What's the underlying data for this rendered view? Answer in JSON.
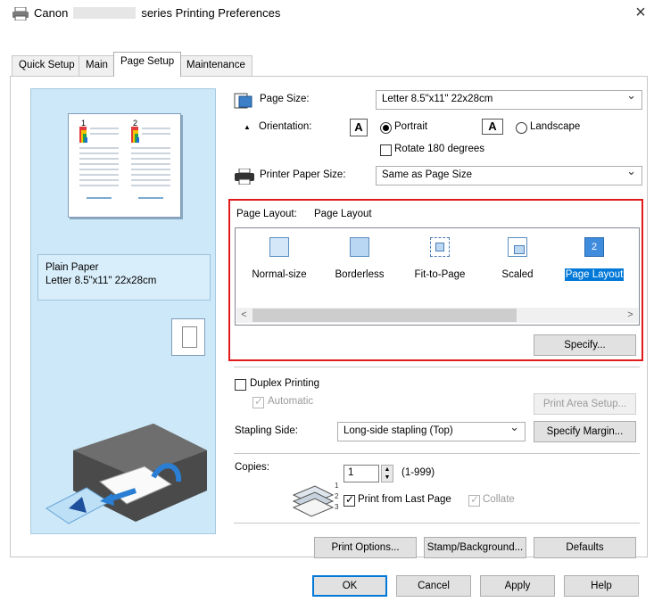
{
  "window": {
    "title_prefix": "Canon",
    "title_suffix": "series Printing Preferences",
    "close_glyph": "×"
  },
  "tabs": [
    {
      "label": "Quick Setup",
      "active": false
    },
    {
      "label": "Main",
      "active": false
    },
    {
      "label": "Page Setup",
      "active": true
    },
    {
      "label": "Maintenance",
      "active": false
    }
  ],
  "preview": {
    "media_type": "Plain Paper",
    "paper_size": "Letter 8.5\"x11\" 22x28cm",
    "page_numbers": [
      "1",
      "2"
    ]
  },
  "page_size": {
    "label": "Page Size:",
    "value": "Letter 8.5\"x11\" 22x28cm"
  },
  "orientation": {
    "label": "Orientation:",
    "portrait_label": "Portrait",
    "landscape_label": "Landscape",
    "selected": "Portrait",
    "portrait_glyph": "A",
    "landscape_glyph": "A",
    "rotate_label": "Rotate 180 degrees",
    "rotate_checked": false
  },
  "printer_paper_size": {
    "label": "Printer Paper Size:",
    "value": "Same as Page Size"
  },
  "page_layout": {
    "label": "Page Layout:",
    "current": "Page Layout",
    "items": [
      {
        "label": "Normal-size",
        "icon": "normal-size-icon"
      },
      {
        "label": "Borderless",
        "icon": "borderless-icon"
      },
      {
        "label": "Fit-to-Page",
        "icon": "fit-to-page-icon"
      },
      {
        "label": "Scaled",
        "icon": "scaled-icon"
      },
      {
        "label": "Page Layout",
        "icon": "page-layout-icon",
        "selected": true,
        "glyph": "2"
      }
    ],
    "scroll_left": "<",
    "scroll_right": ">",
    "specify_button": "Specify..."
  },
  "duplex": {
    "label": "Duplex Printing",
    "checked": false,
    "automatic_label": "Automatic",
    "automatic_checked": true,
    "print_area_button": "Print Area Setup..."
  },
  "stapling": {
    "label": "Stapling Side:",
    "value": "Long-side stapling (Top)",
    "specify_margin_button": "Specify Margin..."
  },
  "copies": {
    "label": "Copies:",
    "value": "1",
    "range": "(1-999)",
    "last_page_label": "Print from Last Page",
    "last_page_checked": true,
    "collate_label": "Collate",
    "collate_checked": true
  },
  "bottom_buttons": {
    "print_options": "Print Options...",
    "stamp_background": "Stamp/Background...",
    "defaults": "Defaults"
  },
  "dialog_buttons": {
    "ok": "OK",
    "cancel": "Cancel",
    "apply": "Apply",
    "help": "Help"
  },
  "colors": {
    "accent": "#0078d7",
    "highlight_border": "#e11b1b",
    "preview_bg": "#cde8f8"
  }
}
